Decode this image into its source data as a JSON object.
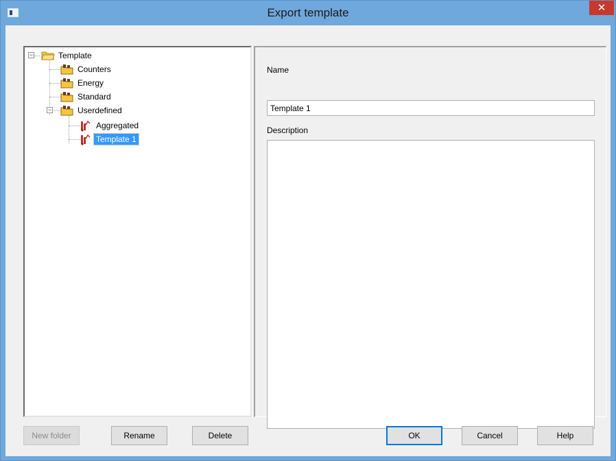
{
  "window": {
    "title": "Export template",
    "close_glyph": "✕",
    "app_icon": "window-app-icon"
  },
  "tree": {
    "root": {
      "label": "Template",
      "icon": "folder-open-icon",
      "expanded": true
    },
    "items": [
      {
        "label": "Counters",
        "icon": "folder-user-icon"
      },
      {
        "label": "Energy",
        "icon": "folder-user-icon"
      },
      {
        "label": "Standard",
        "icon": "folder-user-icon"
      },
      {
        "label": "Userdefined",
        "icon": "folder-user-icon",
        "expanded": true,
        "children": [
          {
            "label": "Aggregated",
            "icon": "template-icon"
          },
          {
            "label": "Template 1",
            "icon": "template-icon",
            "selected": true
          }
        ]
      }
    ],
    "expander_glyph": "−"
  },
  "details": {
    "name_label": "Name",
    "name_value": "Template 1",
    "description_label": "Description",
    "description_value": ""
  },
  "buttons": {
    "new_folder": "New folder",
    "rename": "Rename",
    "delete": "Delete",
    "ok": "OK",
    "cancel": "Cancel",
    "help": "Help"
  },
  "colors": {
    "titlebar": "#6fa8dc",
    "close": "#c7382e",
    "selection": "#3399ff",
    "folder": "#f5c542"
  }
}
